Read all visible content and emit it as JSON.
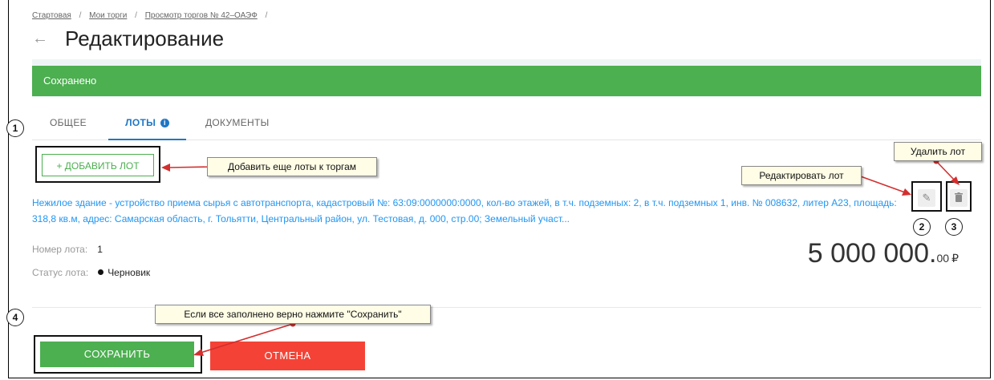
{
  "breadcrumb": {
    "items": [
      "Стартовая",
      "Мои торги",
      "Просмотр торгов № 42–ОАЭФ"
    ],
    "separator": "/"
  },
  "header": {
    "back_icon": "←",
    "title": "Редактирование"
  },
  "notice": {
    "text": "Сохранено",
    "color": "#4caf50"
  },
  "tabs": [
    {
      "label": "ОБЩЕЕ",
      "active": false
    },
    {
      "label": "ЛОТЫ",
      "active": true,
      "badge": "i"
    },
    {
      "label": "ДОКУМЕНТЫ",
      "active": false
    }
  ],
  "lots": {
    "add_label": "+ ДОБАВИТЬ ЛОТ",
    "description": "Нежилое здание - устройство приема сырья с автотранспорта, кадастровый №: 63:09:0000000:0000, кол-во этажей, в т.ч. подземных: 2, в т.ч. подземных 1, инв. № 008632, литер А23, площадь: 318,8 кв.м, адрес: Самарская область, г. Тольятти, Центральный район, ул. Тестовая, д. 000, стр.00; Земельный участ...",
    "number_label": "Номер лота:",
    "number_value": "1",
    "status_label": "Статус лота:",
    "status_value": "Черновик",
    "price_main": "5 000 000.",
    "price_cents": "00",
    "currency": "₽",
    "edit_icon": "pencil-icon",
    "delete_icon": "trash-icon"
  },
  "actions": {
    "save_label": "СОХРАНИТЬ",
    "cancel_label": "ОТМЕНА",
    "save_color": "#4caf50",
    "cancel_color": "#f44336"
  },
  "annotations": {
    "add_hint": "Добавить еще лоты к торгам",
    "edit_hint": "Редактировать лот",
    "delete_hint": "Удалить лот",
    "save_hint": "Если все заполнено верно нажмите \"Сохранить\"",
    "markers": [
      "1",
      "2",
      "3",
      "4"
    ],
    "arrow_color": "#d32f2f"
  }
}
